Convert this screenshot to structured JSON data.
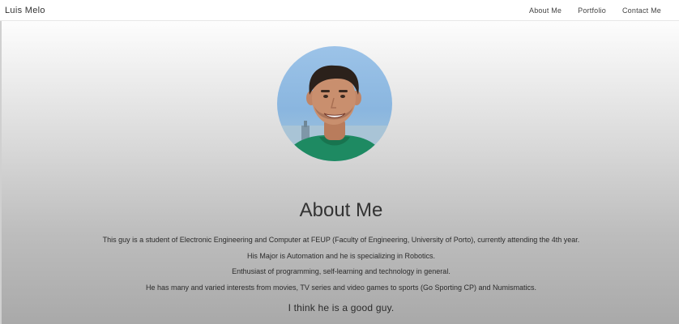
{
  "navbar": {
    "brand": "Luis Melo",
    "links": [
      "About Me",
      "Portfolio",
      "Contact Me"
    ]
  },
  "about": {
    "title": "About Me",
    "paragraphs": [
      "This guy is a student of Electronic Engineering and Computer at FEUP (Faculty of Engineering, University of Porto), currently attending the 4th year.",
      "His Major is Automation and he is specializing in Robotics.",
      "Enthusiast of programming, self-learning and technology in general.",
      "He has many and varied interests from movies, TV series and video games to sports (Go Sporting CP) and Numismatics."
    ],
    "tagline": "I think he is a good guy."
  },
  "colors": {
    "sky": "#9cc3e8",
    "shirt": "#1e8a62",
    "hair": "#2b211b",
    "skin": "#c98f6e"
  }
}
